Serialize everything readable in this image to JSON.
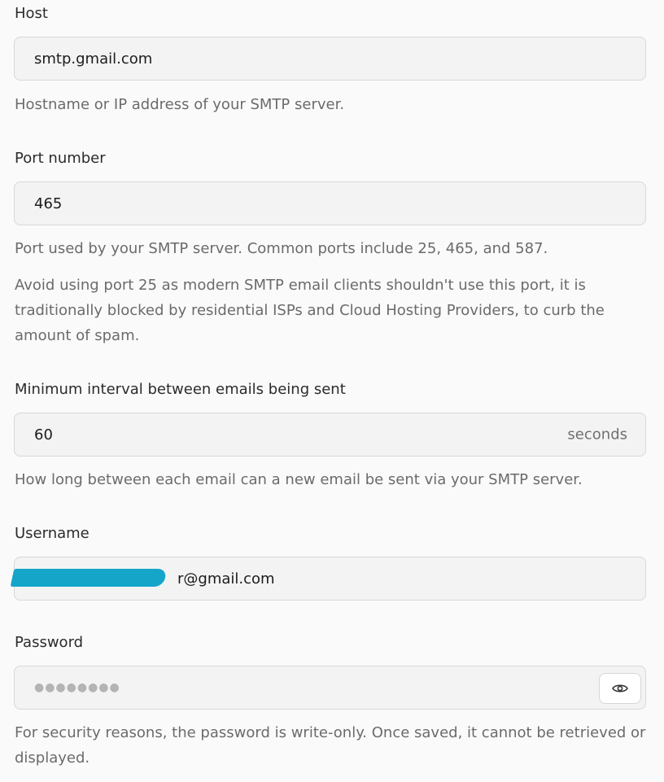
{
  "host": {
    "label": "Host",
    "value": "smtp.gmail.com",
    "help": "Hostname or IP address of your SMTP server."
  },
  "port": {
    "label": "Port number",
    "value": "465",
    "help1": "Port used by your SMTP server. Common ports include 25, 465, and 587.",
    "help2": "Avoid using port 25 as modern SMTP email clients shouldn't use this port, it is traditionally blocked by residential ISPs and Cloud Hosting Providers, to curb the amount of spam."
  },
  "interval": {
    "label": "Minimum interval between emails being sent",
    "value": "60",
    "suffix": "seconds",
    "help": "How long between each email can a new email be sent via your SMTP server."
  },
  "username": {
    "label": "Username",
    "value_visible_suffix": "r@gmail.com"
  },
  "password": {
    "label": "Password",
    "masked_value": "●●●●●●●●",
    "toggle_icon": "eye-icon",
    "help": "For security reasons, the password is write-only. Once saved, it cannot be retrieved or displayed."
  },
  "colors": {
    "redaction": "#14a5c9",
    "input_bg": "#f3f3f3",
    "border": "#d8d8d8"
  }
}
